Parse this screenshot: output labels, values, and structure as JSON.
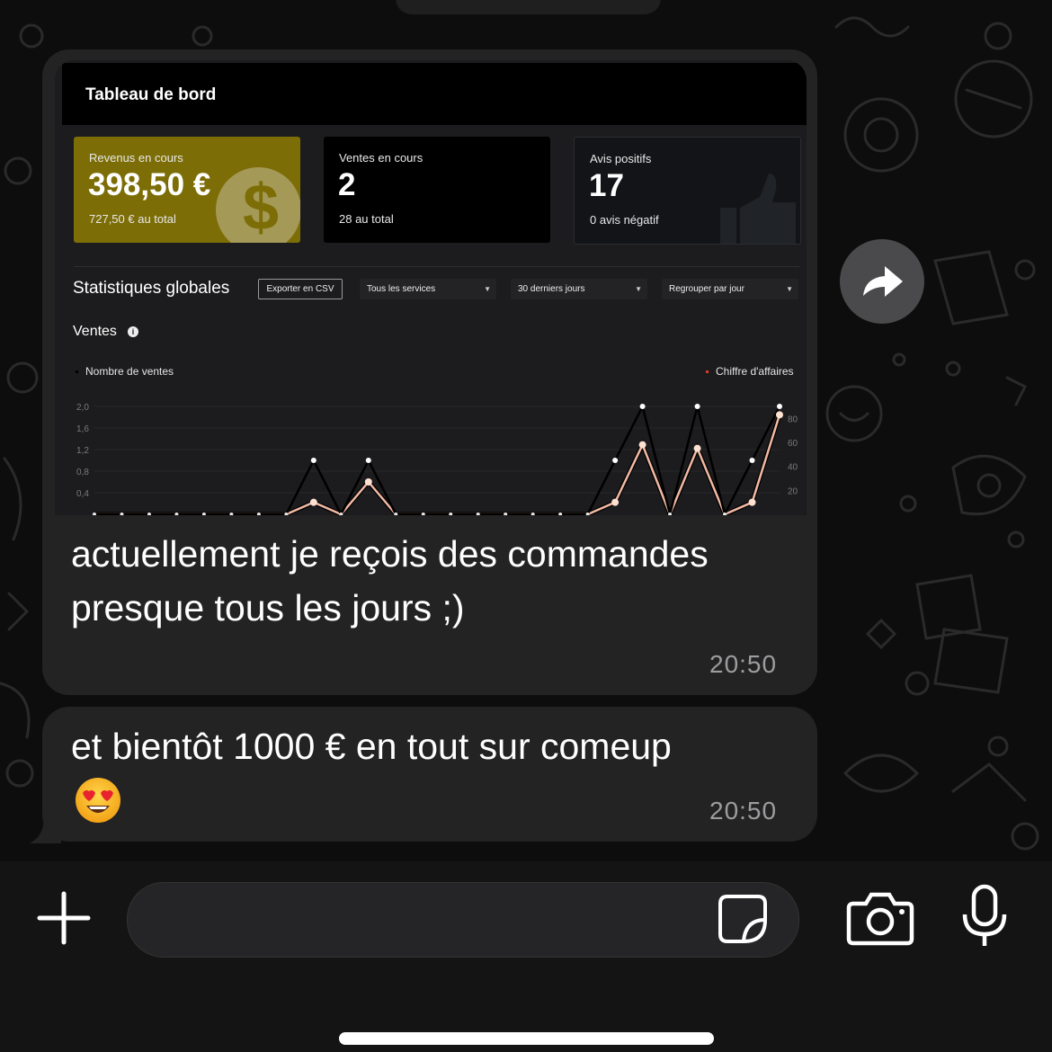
{
  "dashboard": {
    "title": "Tableau de bord",
    "cards": [
      {
        "label": "Revenus en cours",
        "value": "398,50 €",
        "sub": "727,50 € au total",
        "icon": "dollar-icon",
        "color": "#7c6d06"
      },
      {
        "label": "Ventes en cours",
        "value": "2",
        "sub": "28 au total"
      },
      {
        "label": "Avis positifs",
        "value": "17",
        "sub": "0 avis négatif",
        "icon": "thumbs-up-icon"
      }
    ],
    "stats_title": "Statistiques globales",
    "export_label": "Exporter en CSV",
    "filters": [
      "Tous les services",
      "30 derniers jours",
      "Regrouper par jour"
    ],
    "sales_title": "Ventes",
    "legend_left": "Nombre de ventes",
    "legend_right": "Chiffre d'affaires"
  },
  "chart_data": {
    "type": "line",
    "title": "Ventes",
    "series": [
      {
        "name": "Nombre de ventes",
        "color": "#000000",
        "axis": "left",
        "values": [
          0,
          0,
          0,
          0,
          0,
          0,
          0,
          0,
          1,
          0,
          1,
          0,
          0,
          0,
          0,
          0,
          0,
          0,
          0,
          1,
          2,
          0,
          2,
          0,
          1,
          2
        ]
      },
      {
        "name": "Chiffre d'affaires",
        "color": "#f2b9a3",
        "axis": "right",
        "values": [
          0,
          0,
          0,
          0,
          0,
          0,
          0,
          0,
          10,
          0,
          27,
          0,
          0,
          0,
          0,
          0,
          0,
          0,
          0,
          10,
          58,
          0,
          55,
          0,
          10,
          83
        ]
      }
    ],
    "y_left_ticks": [
      "2,0",
      "1,6",
      "1,2",
      "0,8",
      "0,4"
    ],
    "y_right_ticks": [
      "80",
      "60",
      "40",
      "20"
    ],
    "ylim_left": [
      0,
      2.0
    ],
    "ylim_right": [
      0,
      90
    ],
    "grid": true
  },
  "messages": [
    {
      "text": "actuellement je reçois des commandes presque tous les jours ;)",
      "time": "20:50"
    },
    {
      "text": "et bientôt 1000 € en tout sur comeup",
      "emoji": "heart-eyes-emoji",
      "time": "20:50"
    }
  ],
  "composer": {
    "placeholder": "",
    "icons": [
      "plus-icon",
      "sticker-icon",
      "camera-icon",
      "microphone-icon"
    ]
  },
  "forward_icon": "forward-arrow-icon"
}
